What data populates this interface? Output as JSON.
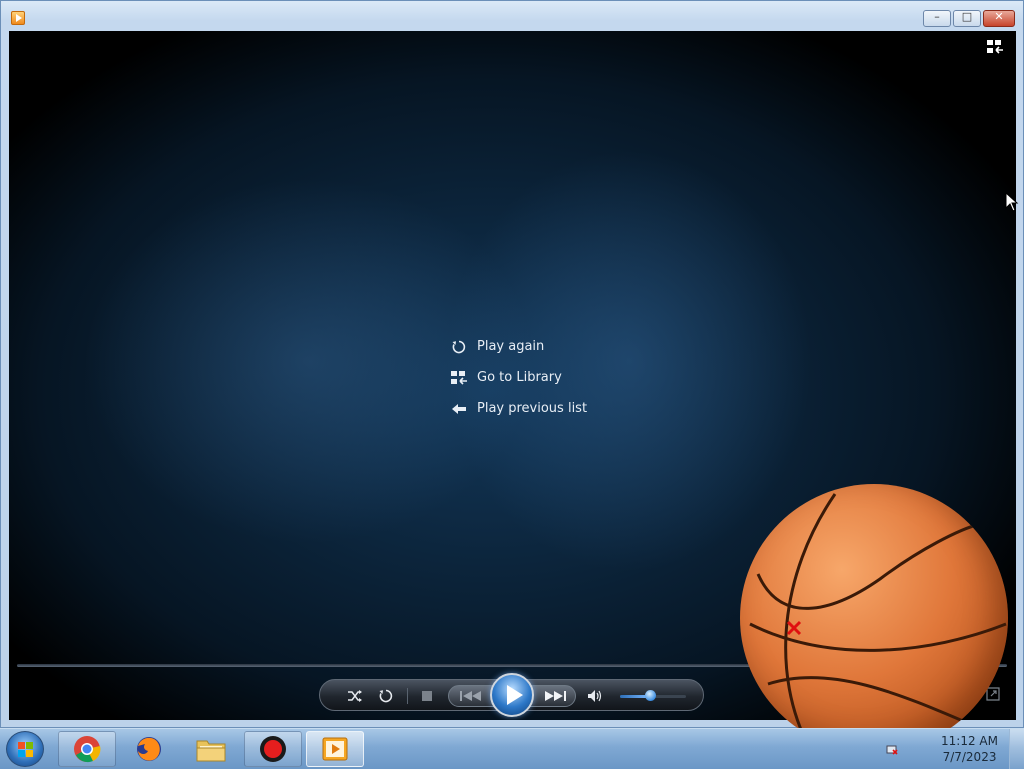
{
  "window": {
    "title": "",
    "buttons": {
      "minimize": "–",
      "maximize": "□",
      "close": "✕"
    }
  },
  "menu": {
    "items": [
      {
        "id": "play-again",
        "label": "Play again",
        "icon": "replay-icon"
      },
      {
        "id": "go-to-library",
        "label": "Go to Library",
        "icon": "library-icon"
      },
      {
        "id": "play-previous-list",
        "label": "Play previous list",
        "icon": "back-arrow-icon"
      }
    ]
  },
  "controls": {
    "shuffle_icon": "shuffle-icon",
    "repeat_icon": "repeat-icon",
    "stop_icon": "stop-icon",
    "previous_icon": "previous-icon",
    "play_icon": "play-icon",
    "next_icon": "next-icon",
    "mute_icon": "volume-icon",
    "volume_level": 0.45
  },
  "taskbar": {
    "apps": [
      {
        "name": "chrome",
        "icon": "chrome-icon"
      },
      {
        "name": "firefox",
        "icon": "firefox-icon"
      },
      {
        "name": "file-explorer",
        "icon": "folder-icon"
      },
      {
        "name": "recorder",
        "icon": "record-icon"
      },
      {
        "name": "media-player",
        "icon": "media-player-icon"
      }
    ],
    "clock": {
      "time": "11:12 AM",
      "date": "7/7/2023"
    }
  },
  "colors": {
    "accent": "#2d78c8",
    "menu_text": "#e8eef5",
    "stage_bg": "#061523"
  }
}
